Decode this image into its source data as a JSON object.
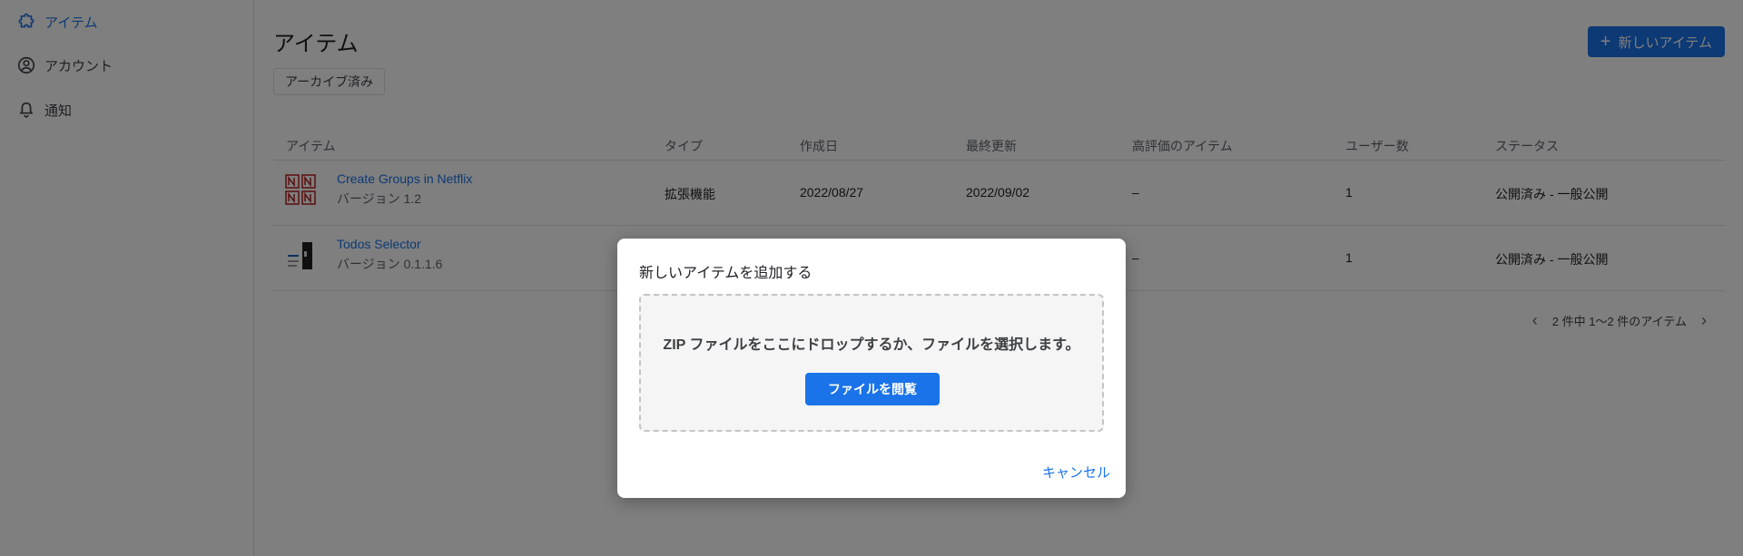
{
  "sidebar": {
    "items": [
      {
        "label": "アイテム",
        "icon": "puzzle-icon",
        "active": true
      },
      {
        "label": "アカウント",
        "icon": "account-circle-icon",
        "active": false
      },
      {
        "label": "通知",
        "icon": "bell-icon",
        "active": false
      }
    ]
  },
  "main": {
    "title": "アイテム",
    "archive_label": "アーカイブ済み",
    "new_item_label": "新しいアイテム",
    "table": {
      "headers": [
        "アイテム",
        "タイプ",
        "作成日",
        "最終更新",
        "高評価のアイテム",
        "ユーザー数",
        "ステータス"
      ],
      "rows": [
        {
          "name": "Create Groups in Netflix",
          "version": "バージョン 1.2",
          "type": "拡張機能",
          "created": "2022/08/27",
          "updated": "2022/09/02",
          "featured": "–",
          "users": "1",
          "status": "公開済み - 一般公開"
        },
        {
          "name": "Todos Selector",
          "version": "バージョン 0.1.1.6",
          "type": "",
          "created": "",
          "updated": "",
          "featured": "–",
          "users": "1",
          "status": "公開済み - 一般公開"
        }
      ]
    },
    "pagination": "2 件中 1〜2 件のアイテム"
  },
  "dialog": {
    "title": "新しいアイテムを追加する",
    "drop_text": "ZIP ファイルをここにドロップするか、ファイルを選択します。",
    "browse_label": "ファイルを閲覧",
    "cancel_label": "キャンセル"
  },
  "colors": {
    "accent": "#1a73e8",
    "overlay": "rgba(0,0,0,0.5)"
  }
}
